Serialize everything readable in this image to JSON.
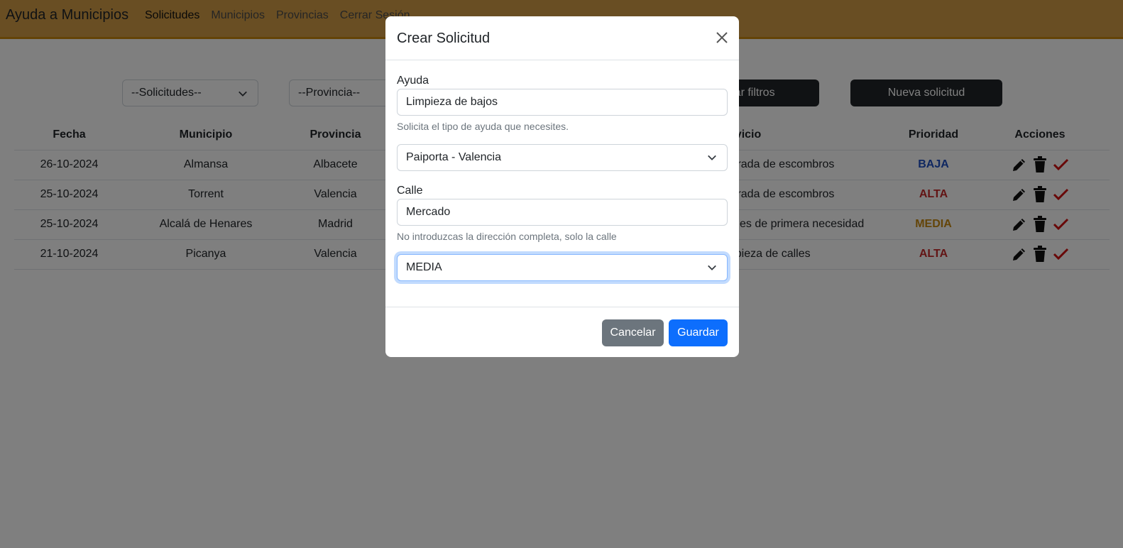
{
  "navbar": {
    "brand": "Ayuda a Municipios",
    "links": [
      "Solicitudes",
      "Municipios",
      "Provincias",
      "Cerrar Sesión"
    ]
  },
  "filters": {
    "solicitudes": "--Solicitudes--",
    "provincia": "--Provincia--",
    "clear_label": "Borrar filtros",
    "new_label": "Nueva solicitud"
  },
  "table": {
    "headers": [
      "Fecha",
      "Municipio",
      "Provincia",
      "Servicio",
      "Prioridad",
      "Acciones"
    ],
    "rows": [
      {
        "fecha": "26-10-2024",
        "municipio": "Almansa",
        "provincia": "Albacete",
        "servicio": "Retirada de escombros",
        "prioridad": "BAJA",
        "color": "#1e4fc2"
      },
      {
        "fecha": "25-10-2024",
        "municipio": "Torrent",
        "provincia": "Valencia",
        "servicio": "Retirada de escombros",
        "prioridad": "ALTA",
        "color": "#c62828"
      },
      {
        "fecha": "25-10-2024",
        "municipio": "Alcalá de Henares",
        "provincia": "Madrid",
        "servicio": "Bienes de primera necesidad",
        "prioridad": "MEDIA",
        "color": "#c98a12"
      },
      {
        "fecha": "21-10-2024",
        "municipio": "Picanya",
        "provincia": "Valencia",
        "servicio": "Limpieza de calles",
        "prioridad": "ALTA",
        "color": "#c62828"
      }
    ]
  },
  "modal": {
    "title": "Crear Solicitud",
    "ayuda_label": "Ayuda",
    "ayuda_value": "Limpieza de bajos",
    "ayuda_help": "Solicita el tipo de ayuda que necesites.",
    "municipio_value": "Paiporta - Valencia",
    "calle_label": "Calle",
    "calle_value": "Mercado",
    "calle_help": "No introduzcas la dirección completa, solo la calle",
    "prioridad_value": "MEDIA",
    "cancel_label": "Cancelar",
    "save_label": "Guardar"
  }
}
